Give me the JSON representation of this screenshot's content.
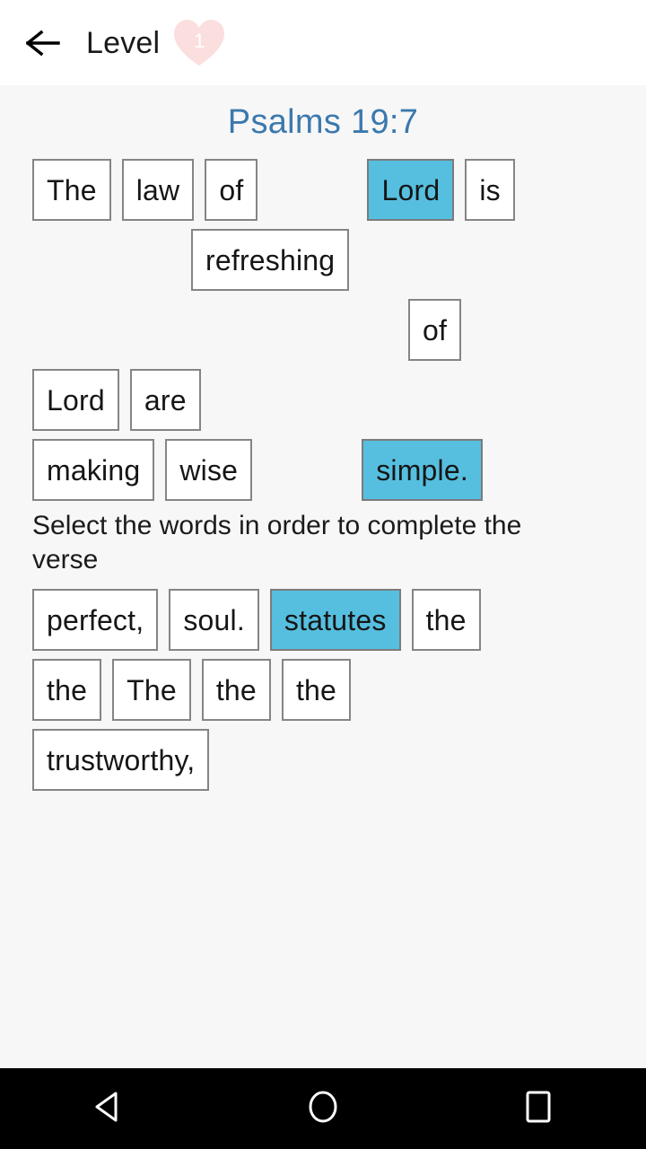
{
  "header": {
    "back_icon": "arrow-left-icon",
    "title": "Level",
    "lives_icon": "heart-icon",
    "lives_count": "1",
    "heart_color": "#fbdede",
    "title_color": "#1a1a1a"
  },
  "verse": {
    "reference": "Psalms 19:7",
    "reference_color": "#3b79ad"
  },
  "instruction": {
    "text": "Select the words in order to complete the verse"
  },
  "colors": {
    "selected_tile": "#56bfdf",
    "tile_border": "#858585",
    "tile_background": "#ffffff",
    "page_background": "#f7f7f7",
    "appbar_background": "#ffffff",
    "navbar_background": "#000000"
  },
  "answer_area": {
    "rows": [
      {
        "tiles": [
          {
            "label": "The",
            "selected": false,
            "indent": 0
          },
          {
            "label": "law",
            "selected": false,
            "indent": 0
          },
          {
            "label": "of",
            "selected": false,
            "indent": 0
          },
          {
            "label": "Lord",
            "selected": true,
            "indent": 110
          },
          {
            "label": "is",
            "selected": false,
            "indent": 0
          }
        ]
      },
      {
        "tiles": [
          {
            "label": "refreshing",
            "selected": false,
            "indent": 177
          }
        ]
      },
      {
        "tiles": [
          {
            "label": "of",
            "selected": false,
            "indent": 419
          }
        ]
      },
      {
        "tiles": [
          {
            "label": "Lord",
            "selected": false,
            "indent": 0
          },
          {
            "label": "are",
            "selected": false,
            "indent": 0
          }
        ]
      },
      {
        "tiles": [
          {
            "label": "making",
            "selected": false,
            "indent": 0
          },
          {
            "label": "wise",
            "selected": false,
            "indent": 0
          },
          {
            "label": "simple.",
            "selected": true,
            "indent": 110
          }
        ]
      }
    ]
  },
  "word_bank": {
    "rows": [
      {
        "tiles": [
          {
            "label": "perfect,",
            "selected": false,
            "indent": 0
          },
          {
            "label": "soul.",
            "selected": false,
            "indent": 0
          },
          {
            "label": "statutes",
            "selected": true,
            "indent": 0
          },
          {
            "label": "the",
            "selected": false,
            "indent": 0
          }
        ]
      },
      {
        "tiles": [
          {
            "label": "the",
            "selected": false,
            "indent": 0
          },
          {
            "label": "The",
            "selected": false,
            "indent": 0
          },
          {
            "label": "the",
            "selected": false,
            "indent": 0
          },
          {
            "label": "the",
            "selected": false,
            "indent": 0
          }
        ]
      },
      {
        "tiles": [
          {
            "label": "trustworthy,",
            "selected": false,
            "indent": 0
          }
        ]
      }
    ]
  },
  "navbar": {
    "buttons": [
      {
        "name": "nav-back-icon",
        "shape": "triangle-left"
      },
      {
        "name": "nav-home-icon",
        "shape": "circle"
      },
      {
        "name": "nav-recents-icon",
        "shape": "square"
      }
    ]
  }
}
